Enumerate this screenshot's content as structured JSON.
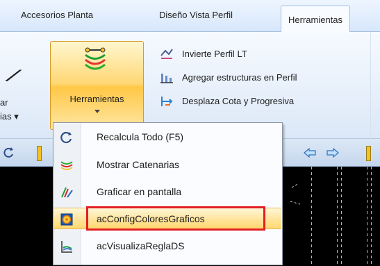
{
  "tabs": [
    {
      "label": "Accesorios Planta",
      "active": false
    },
    {
      "label": "Diseño Vista Perfil",
      "active": false
    },
    {
      "label": "Herramientas",
      "active": true
    }
  ],
  "ribbon": {
    "left_partial_text_1": "ar",
    "left_partial_text_2": "ias ▾",
    "herramientas_button": {
      "label": "Herramientas",
      "icon": "tools-catenary-icon"
    },
    "items": [
      {
        "label": "Invierte Perfil LT",
        "icon": "invert-profile-icon"
      },
      {
        "label": "Agregar estructuras en Perfil",
        "icon": "add-structures-icon"
      },
      {
        "label": "Desplaza Cota y Progresiva",
        "icon": "move-elevation-icon"
      }
    ]
  },
  "toolbar": {
    "items": [
      {
        "name": "refresh-icon"
      },
      {
        "name": "yellow-separator-icon"
      },
      {
        "name": "arrow-left-icon"
      },
      {
        "name": "arrow-right-icon"
      },
      {
        "name": "yellow-separator-icon"
      }
    ]
  },
  "menu": {
    "items": [
      {
        "label": "Recalcula Todo (F5)",
        "icon": "recalculate-icon",
        "highlighted": false
      },
      {
        "label": "Mostrar Catenarias",
        "icon": "catenary-icon",
        "highlighted": false
      },
      {
        "label": "Graficar en pantalla",
        "icon": "plot-screen-icon",
        "highlighted": false
      },
      {
        "label": "acConfigColoresGraficos",
        "icon": "color-config-icon",
        "highlighted": true
      },
      {
        "label": "acVisualizaReglaDS",
        "icon": "ruler-view-icon",
        "highlighted": false
      }
    ]
  },
  "colors": {
    "selection_highlight": "#ffd86e",
    "annotation_box": "#e31e24",
    "catenary_green": "#2eaa2e",
    "catenary_red": "#d9262b",
    "catenary_yellow": "#f2c431"
  }
}
